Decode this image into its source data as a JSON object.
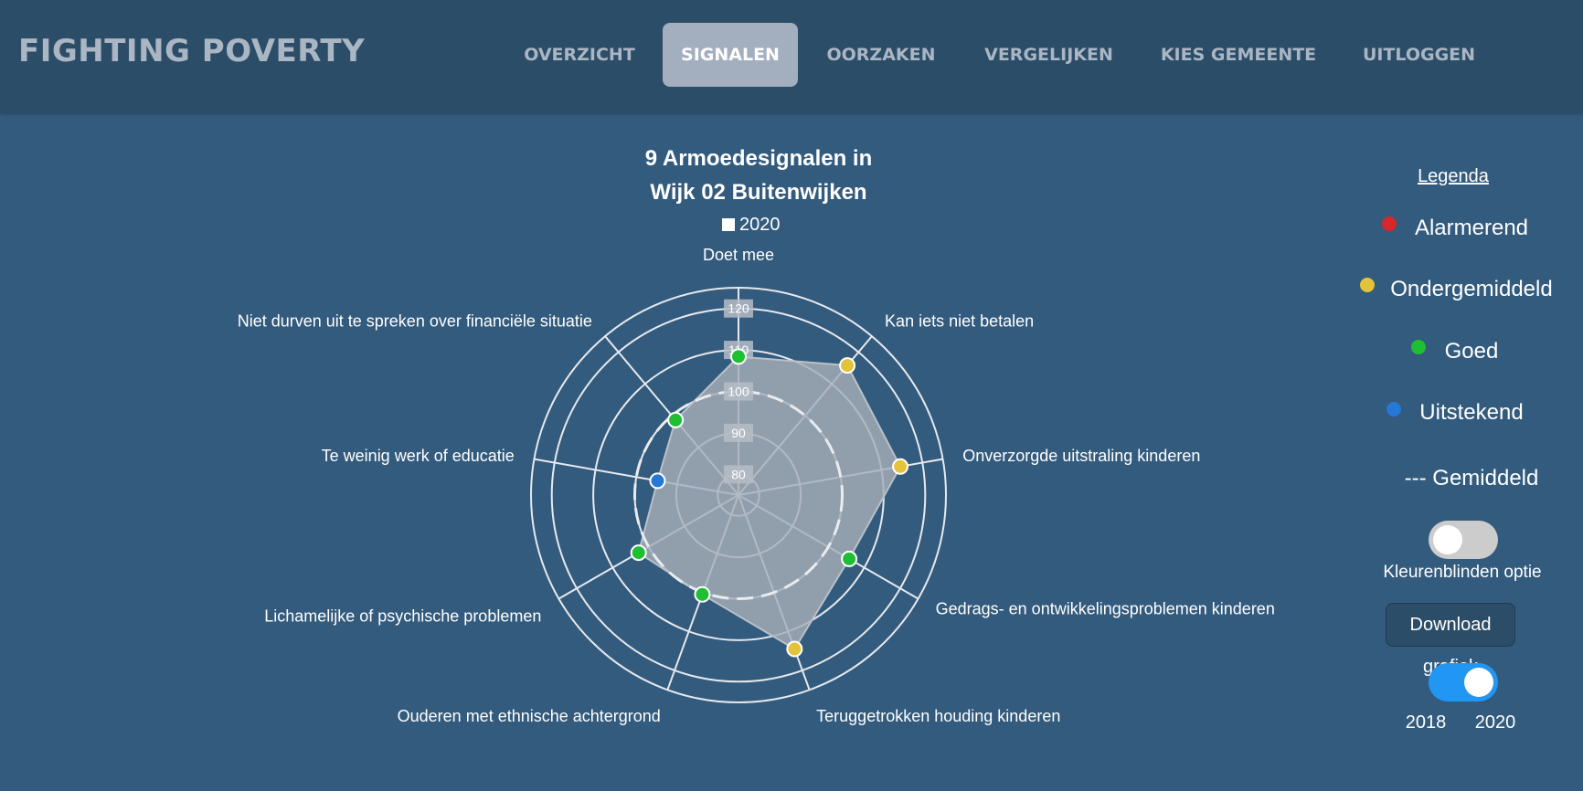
{
  "app": {
    "title": "FIGHTING POVERTY"
  },
  "nav": {
    "items": [
      {
        "label": "OVERZICHT",
        "active": false
      },
      {
        "label": "SIGNALEN",
        "active": true
      },
      {
        "label": "OORZAKEN",
        "active": false
      },
      {
        "label": "VERGELIJKEN",
        "active": false
      },
      {
        "label": "KIES GEMEENTE",
        "active": false
      },
      {
        "label": "UITLOGGEN",
        "active": false
      }
    ]
  },
  "chart": {
    "title_line1": "9 Armoedesignalen in",
    "title_line2": "Wijk 02 Buitenwijken",
    "series_label": "2020"
  },
  "legend": {
    "title": "Legenda",
    "items": [
      {
        "label": "Alarmerend",
        "color": "#d9262a"
      },
      {
        "label": "Ondergemiddeld",
        "color": "#e2c33a"
      },
      {
        "label": "Goed",
        "color": "#1fbf33"
      },
      {
        "label": "Uitstekend",
        "color": "#2678d6"
      }
    ],
    "average_label": "--- Gemiddeld"
  },
  "controls": {
    "colorblind_label": "Kleurenblinden optie",
    "colorblind_on": false,
    "download_label": "Download grafiek",
    "year_toggle_left": "2018",
    "year_toggle_right": "2020",
    "year_toggle_on": true
  },
  "colors": {
    "navbar": "#2c4d68",
    "background": "#335b7d",
    "area_fill": "#a6aeb8",
    "toggle_off": "#cccccc",
    "toggle_on": "#2196f3"
  },
  "chart_data": {
    "type": "radar",
    "title": "9 Armoedesignalen in Wijk 02 Buitenwijken",
    "categories": [
      "Doet mee",
      "Kan iets niet betalen",
      "Onverzorgde uitstraling kinderen",
      "Gedrags- en ontwikkelingsproblemen kinderen",
      "Teruggetrokken houding kinderen",
      "Ouderen met ethnische achtergrond",
      "Lichamelijke of psychische problemen",
      "Te weinig werk of educatie",
      "Niet durven uit te spreken over financiële situatie"
    ],
    "series": [
      {
        "name": "2020",
        "values": [
          108.4,
          115.8,
          114.6,
          105.8,
          114.5,
          100.5,
          102.8,
          94.8,
          98.6
        ],
        "status": [
          "Goed",
          "Ondergemiddeld",
          "Ondergemiddeld",
          "Goed",
          "Ondergemiddeld",
          "Goed",
          "Goed",
          "Uitstekend",
          "Goed"
        ]
      }
    ],
    "average": 100,
    "rlim": [
      75,
      125
    ],
    "ticks": [
      80,
      90,
      100,
      110,
      120
    ],
    "grid": true
  }
}
